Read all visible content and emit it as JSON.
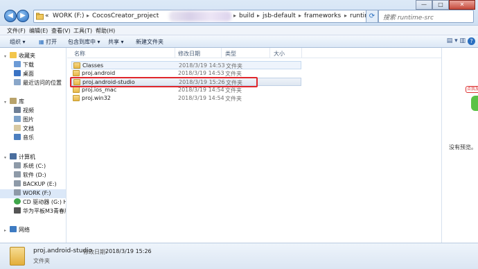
{
  "address": {
    "crumbs": [
      "«",
      "WORK (F:)",
      "CocosCreator_project",
      "build",
      "jsb-default",
      "frameworks",
      "runtime-src"
    ],
    "search_placeholder": "搜索 runtime-src"
  },
  "window_controls": {
    "minimize": "—",
    "maximize": "□",
    "close": "✕"
  },
  "menu": [
    "文件(F)",
    "编辑(E)",
    "查看(V)",
    "工具(T)",
    "帮助(H)"
  ],
  "toolbar": {
    "organize": "组织 ▾",
    "open": "打开",
    "include_in_library": "包含到库中 ▾",
    "share": "共享 ▾",
    "new_folder": "新建文件夹"
  },
  "sidebar": {
    "favorites": {
      "title": "收藏夹",
      "items": [
        "下载",
        "桌面",
        "最近访问的位置"
      ]
    },
    "libraries": {
      "title": "库",
      "items": [
        "视频",
        "图片",
        "文档",
        "音乐"
      ]
    },
    "computer": {
      "title": "计算机",
      "items": [
        "系统 (C:)",
        "软件 (D:)",
        "BACKUP (E:)",
        "WORK (F:)",
        "CD 驱动器 (G:) HiSu",
        "华为平板M3青春版:"
      ]
    },
    "network": {
      "title": "网络"
    }
  },
  "columns": {
    "name": "名称",
    "modified": "修改日期",
    "type": "类型",
    "size": "大小"
  },
  "files": [
    {
      "name": "Classes",
      "modified": "2018/3/19 14:53",
      "type": "文件夹"
    },
    {
      "name": "proj.android",
      "modified": "2018/3/19 14:53",
      "type": "文件夹"
    },
    {
      "name": "proj.android-studio",
      "modified": "2018/3/19 15:26",
      "type": "文件夹"
    },
    {
      "name": "proj.ios_mac",
      "modified": "2018/3/19 14:54",
      "type": "文件夹"
    },
    {
      "name": "proj.win32",
      "modified": "2018/3/19 14:54",
      "type": "文件夹"
    }
  ],
  "preview": {
    "empty_text": "没有预览。",
    "badge": "点我加"
  },
  "details": {
    "name": "proj.android-studio",
    "date_label": "修改日期:",
    "date": "2018/3/19 15:26",
    "type": "文件夹"
  },
  "colors": {
    "highlight": "#e0262b",
    "accent": "#2a6fc0"
  }
}
